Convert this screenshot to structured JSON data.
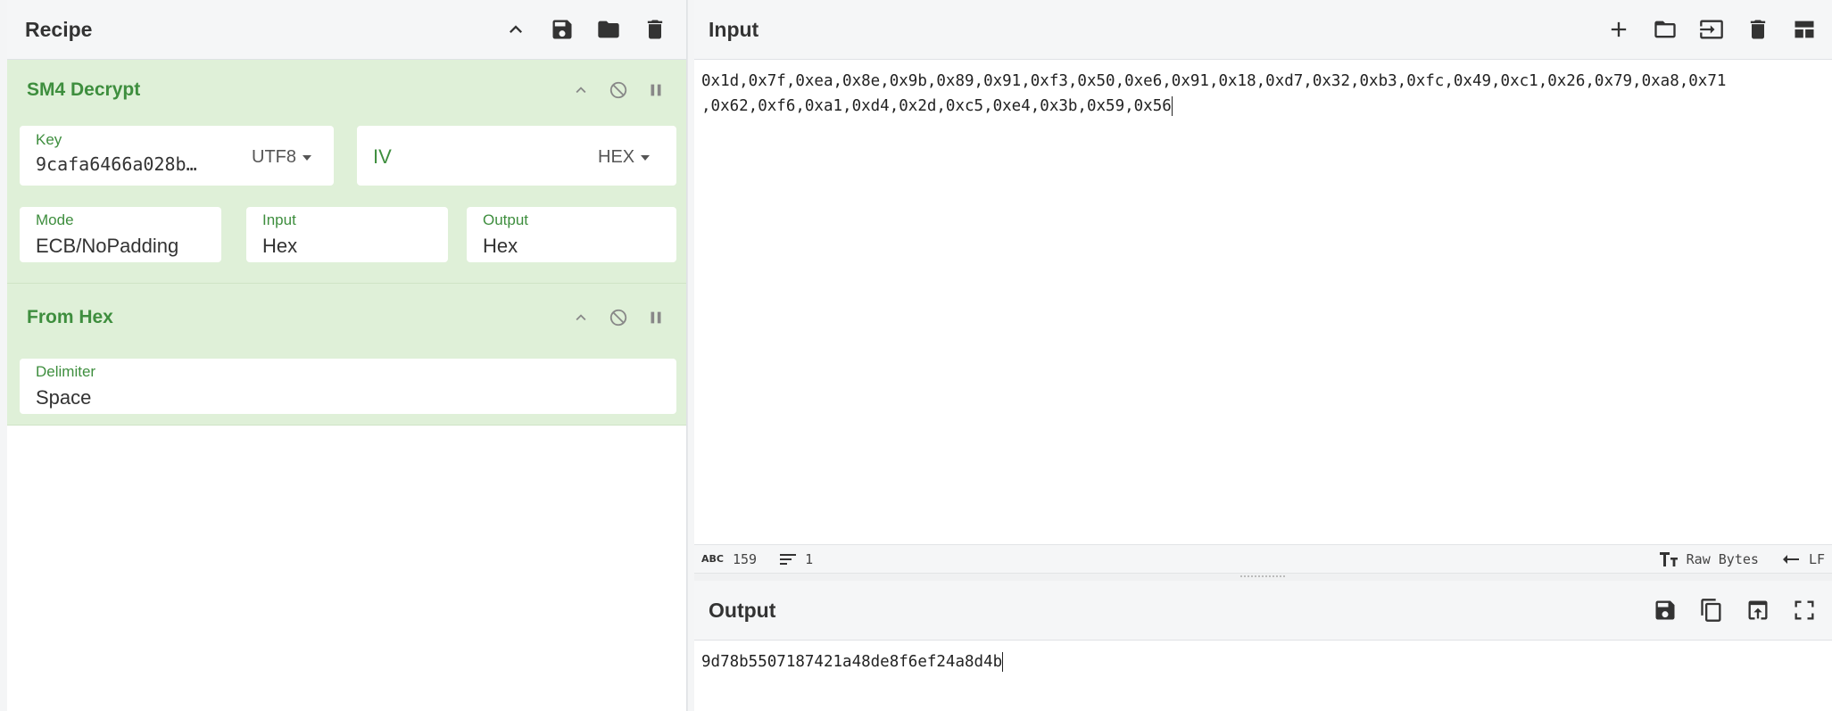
{
  "recipe": {
    "title": "Recipe",
    "operations": [
      {
        "name": "SM4 Decrypt",
        "key_label": "Key",
        "key_value": "9cafa6466a028b…",
        "key_encoding": "UTF8",
        "iv_placeholder": "IV",
        "iv_encoding": "HEX",
        "mode_label": "Mode",
        "mode_value": "ECB/NoPadding",
        "input_label": "Input",
        "input_value": "Hex",
        "output_label": "Output",
        "output_value": "Hex"
      },
      {
        "name": "From Hex",
        "delimiter_label": "Delimiter",
        "delimiter_value": "Space"
      }
    ]
  },
  "input": {
    "title": "Input",
    "text": "0x1d,0x7f,0xea,0x8e,0x9b,0x89,0x91,0xf3,0x50,0xe6,0x91,0x18,0xd7,0x32,0xb3,0xfc,0x49,0xc1,0x26,0x79,0xa8,0x71,0x62,0xf6,0xa1,0xd4,0x2d,0xc5,0xe4,0x3b,0x59,0x56",
    "line1": "0x1d,0x7f,0xea,0x8e,0x9b,0x89,0x91,0xf3,0x50,0xe6,0x91,0x18,0xd7,0x32,0xb3,0xfc,0x49,0xc1,0x26,0x79,0xa8,0x71",
    "line2": ",0x62,0xf6,0xa1,0xd4,0x2d,0xc5,0xe4,0x3b,0x59,0x56",
    "status": {
      "char_icon": "ABC",
      "char_count": "159",
      "line_count": "1",
      "encoding": "Raw Bytes",
      "eol": "LF"
    }
  },
  "output": {
    "title": "Output",
    "text": "9d78b5507187421a48de8f6ef24a8d4b"
  },
  "icons": {
    "recipe": [
      "chevron-up-icon",
      "save-icon",
      "folder-icon",
      "trash-icon"
    ],
    "input": [
      "plus-icon",
      "folder-icon",
      "import-icon",
      "trash-icon",
      "layout-icon"
    ],
    "output": [
      "save-icon",
      "copy-icon",
      "replace-input-icon",
      "maximize-icon"
    ]
  }
}
